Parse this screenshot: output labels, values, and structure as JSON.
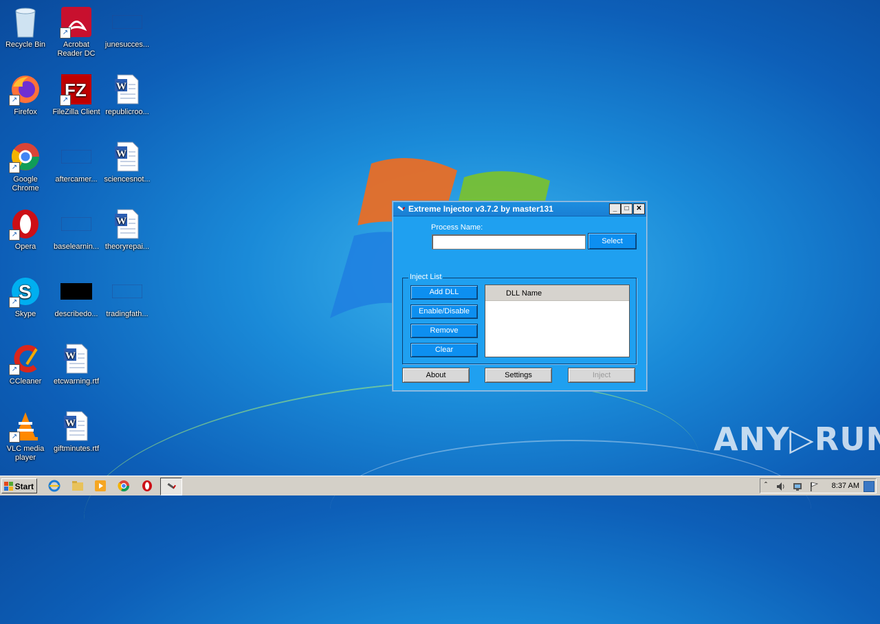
{
  "desktop": {
    "icons": [
      {
        "label": "Recycle Bin",
        "icon": "recycle-bin-icon"
      },
      {
        "label": "Acrobat Reader DC",
        "icon": "acrobat-icon"
      },
      {
        "label": "junesucces...",
        "icon": "blank-file-icon"
      },
      {
        "label": "Firefox",
        "icon": "firefox-icon"
      },
      {
        "label": "FileZilla Client",
        "icon": "filezilla-icon"
      },
      {
        "label": "republicroo...",
        "icon": "word-doc-icon"
      },
      {
        "label": "Google Chrome",
        "icon": "chrome-icon"
      },
      {
        "label": "aftercamer...",
        "icon": "blank-file-icon"
      },
      {
        "label": "sciencesnot...",
        "icon": "word-doc-icon"
      },
      {
        "label": "Opera",
        "icon": "opera-icon"
      },
      {
        "label": "baselearnin...",
        "icon": "blank-file-icon"
      },
      {
        "label": "theoryrepai...",
        "icon": "word-doc-icon"
      },
      {
        "label": "Skype",
        "icon": "skype-icon"
      },
      {
        "label": "describedo...",
        "icon": "black-file-icon"
      },
      {
        "label": "tradingfath...",
        "icon": "blank-file-icon"
      },
      {
        "label": "CCleaner",
        "icon": "ccleaner-icon"
      },
      {
        "label": "etcwarning.rtf",
        "icon": "word-doc-icon"
      },
      {
        "label": "VLC media player",
        "icon": "vlc-icon"
      },
      {
        "label": "giftminutes.rtf",
        "icon": "word-doc-icon"
      }
    ]
  },
  "window": {
    "title": "Extreme Injector v3.7.2 by master131",
    "minimize": "_",
    "maximize": "□",
    "close": "✕",
    "process_label": "Process Name:",
    "process_value": "",
    "select_label": "Select",
    "inject_list_legend": "Inject List",
    "add_dll": "Add DLL",
    "enable_disable": "Enable/Disable",
    "remove": "Remove",
    "clear": "Clear",
    "list_header": "DLL Name",
    "about": "About",
    "settings": "Settings",
    "inject": "Inject"
  },
  "taskbar": {
    "start_label": "Start",
    "clock": "8:37 AM",
    "tray_arrow": "ˆ"
  },
  "watermark": "ANY▷RUN",
  "colors": {
    "window_bg": "#1fa0f0",
    "titlebar": "#1a7fd4",
    "taskbar": "#d4d0c8"
  }
}
